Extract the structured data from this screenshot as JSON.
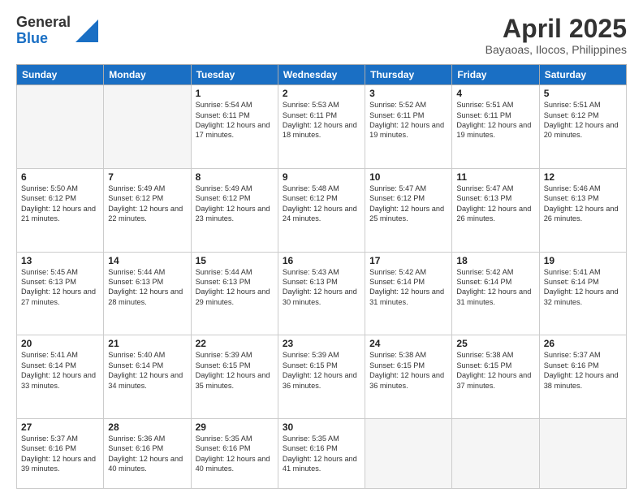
{
  "logo": {
    "general": "General",
    "blue": "Blue"
  },
  "title": "April 2025",
  "subtitle": "Bayaoas, Ilocos, Philippines",
  "weekdays": [
    "Sunday",
    "Monday",
    "Tuesday",
    "Wednesday",
    "Thursday",
    "Friday",
    "Saturday"
  ],
  "weeks": [
    [
      {
        "day": "",
        "info": ""
      },
      {
        "day": "",
        "info": ""
      },
      {
        "day": "1",
        "info": "Sunrise: 5:54 AM\nSunset: 6:11 PM\nDaylight: 12 hours and 17 minutes."
      },
      {
        "day": "2",
        "info": "Sunrise: 5:53 AM\nSunset: 6:11 PM\nDaylight: 12 hours and 18 minutes."
      },
      {
        "day": "3",
        "info": "Sunrise: 5:52 AM\nSunset: 6:11 PM\nDaylight: 12 hours and 19 minutes."
      },
      {
        "day": "4",
        "info": "Sunrise: 5:51 AM\nSunset: 6:11 PM\nDaylight: 12 hours and 19 minutes."
      },
      {
        "day": "5",
        "info": "Sunrise: 5:51 AM\nSunset: 6:12 PM\nDaylight: 12 hours and 20 minutes."
      }
    ],
    [
      {
        "day": "6",
        "info": "Sunrise: 5:50 AM\nSunset: 6:12 PM\nDaylight: 12 hours and 21 minutes."
      },
      {
        "day": "7",
        "info": "Sunrise: 5:49 AM\nSunset: 6:12 PM\nDaylight: 12 hours and 22 minutes."
      },
      {
        "day": "8",
        "info": "Sunrise: 5:49 AM\nSunset: 6:12 PM\nDaylight: 12 hours and 23 minutes."
      },
      {
        "day": "9",
        "info": "Sunrise: 5:48 AM\nSunset: 6:12 PM\nDaylight: 12 hours and 24 minutes."
      },
      {
        "day": "10",
        "info": "Sunrise: 5:47 AM\nSunset: 6:12 PM\nDaylight: 12 hours and 25 minutes."
      },
      {
        "day": "11",
        "info": "Sunrise: 5:47 AM\nSunset: 6:13 PM\nDaylight: 12 hours and 26 minutes."
      },
      {
        "day": "12",
        "info": "Sunrise: 5:46 AM\nSunset: 6:13 PM\nDaylight: 12 hours and 26 minutes."
      }
    ],
    [
      {
        "day": "13",
        "info": "Sunrise: 5:45 AM\nSunset: 6:13 PM\nDaylight: 12 hours and 27 minutes."
      },
      {
        "day": "14",
        "info": "Sunrise: 5:44 AM\nSunset: 6:13 PM\nDaylight: 12 hours and 28 minutes."
      },
      {
        "day": "15",
        "info": "Sunrise: 5:44 AM\nSunset: 6:13 PM\nDaylight: 12 hours and 29 minutes."
      },
      {
        "day": "16",
        "info": "Sunrise: 5:43 AM\nSunset: 6:13 PM\nDaylight: 12 hours and 30 minutes."
      },
      {
        "day": "17",
        "info": "Sunrise: 5:42 AM\nSunset: 6:14 PM\nDaylight: 12 hours and 31 minutes."
      },
      {
        "day": "18",
        "info": "Sunrise: 5:42 AM\nSunset: 6:14 PM\nDaylight: 12 hours and 31 minutes."
      },
      {
        "day": "19",
        "info": "Sunrise: 5:41 AM\nSunset: 6:14 PM\nDaylight: 12 hours and 32 minutes."
      }
    ],
    [
      {
        "day": "20",
        "info": "Sunrise: 5:41 AM\nSunset: 6:14 PM\nDaylight: 12 hours and 33 minutes."
      },
      {
        "day": "21",
        "info": "Sunrise: 5:40 AM\nSunset: 6:14 PM\nDaylight: 12 hours and 34 minutes."
      },
      {
        "day": "22",
        "info": "Sunrise: 5:39 AM\nSunset: 6:15 PM\nDaylight: 12 hours and 35 minutes."
      },
      {
        "day": "23",
        "info": "Sunrise: 5:39 AM\nSunset: 6:15 PM\nDaylight: 12 hours and 36 minutes."
      },
      {
        "day": "24",
        "info": "Sunrise: 5:38 AM\nSunset: 6:15 PM\nDaylight: 12 hours and 36 minutes."
      },
      {
        "day": "25",
        "info": "Sunrise: 5:38 AM\nSunset: 6:15 PM\nDaylight: 12 hours and 37 minutes."
      },
      {
        "day": "26",
        "info": "Sunrise: 5:37 AM\nSunset: 6:16 PM\nDaylight: 12 hours and 38 minutes."
      }
    ],
    [
      {
        "day": "27",
        "info": "Sunrise: 5:37 AM\nSunset: 6:16 PM\nDaylight: 12 hours and 39 minutes."
      },
      {
        "day": "28",
        "info": "Sunrise: 5:36 AM\nSunset: 6:16 PM\nDaylight: 12 hours and 40 minutes."
      },
      {
        "day": "29",
        "info": "Sunrise: 5:35 AM\nSunset: 6:16 PM\nDaylight: 12 hours and 40 minutes."
      },
      {
        "day": "30",
        "info": "Sunrise: 5:35 AM\nSunset: 6:16 PM\nDaylight: 12 hours and 41 minutes."
      },
      {
        "day": "",
        "info": ""
      },
      {
        "day": "",
        "info": ""
      },
      {
        "day": "",
        "info": ""
      }
    ]
  ]
}
